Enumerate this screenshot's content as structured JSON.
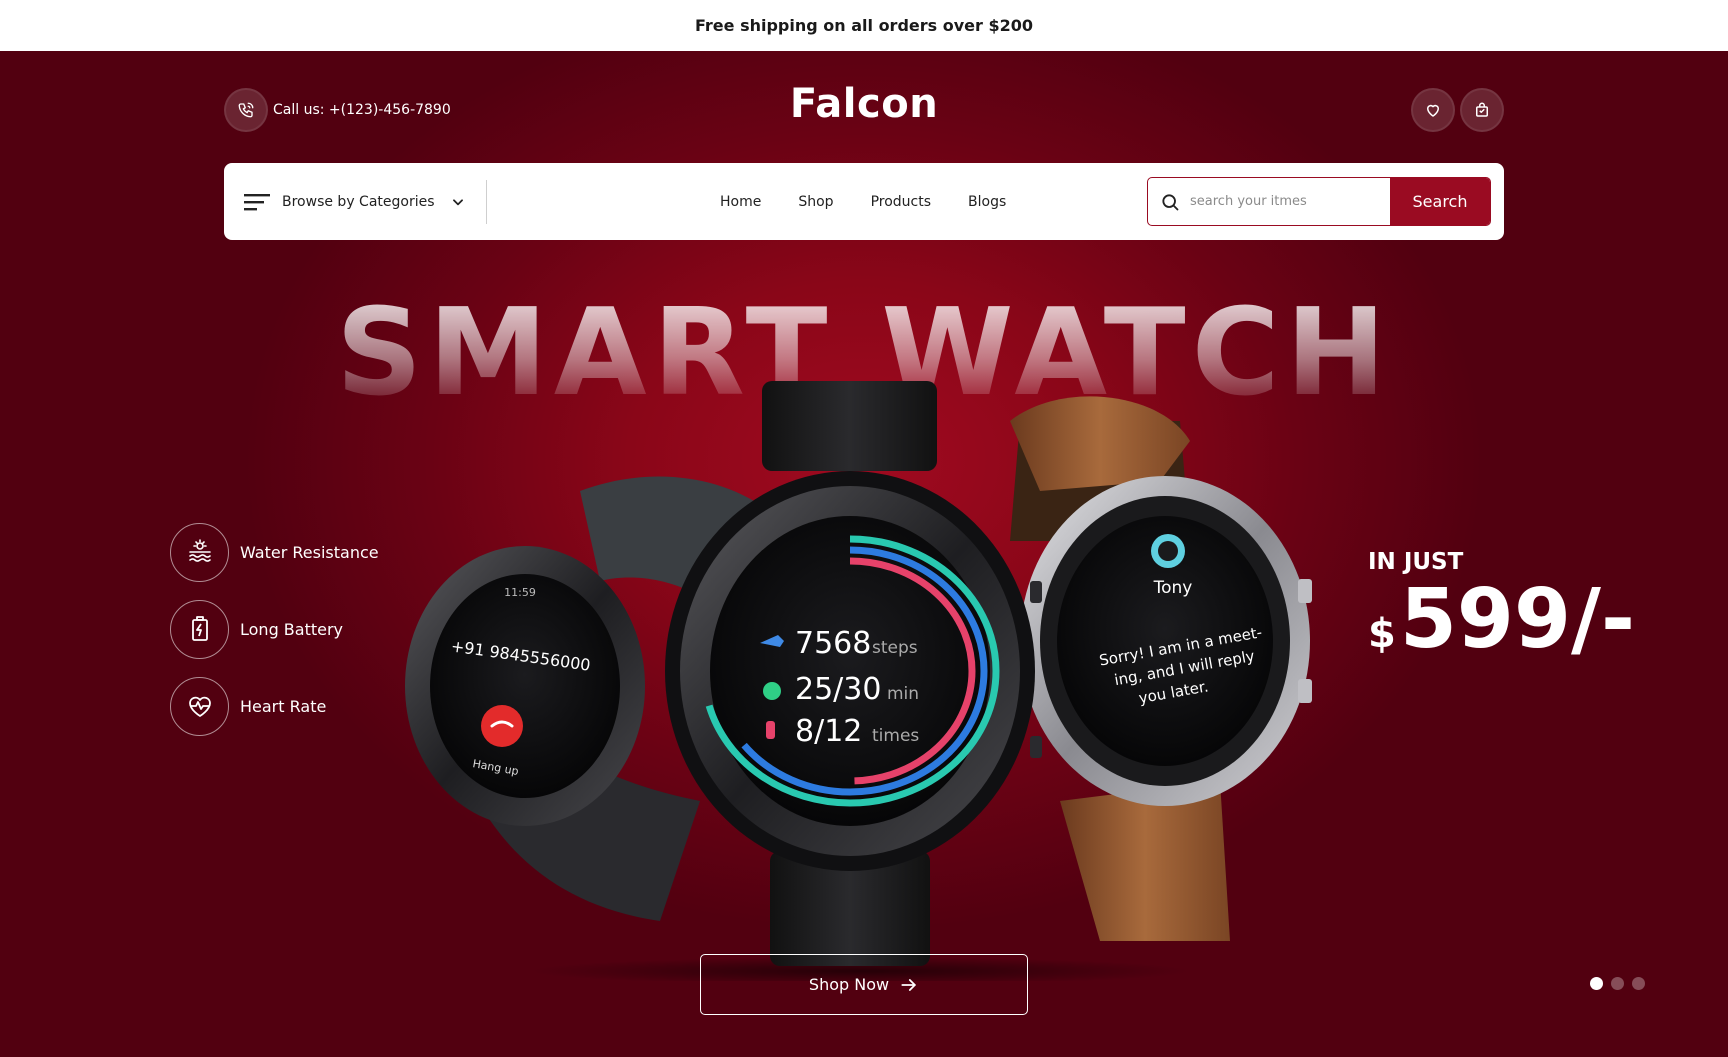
{
  "announcement": "Free shipping on all orders over $200",
  "header": {
    "phone_label": "Call us: +(123)-456-7890",
    "logo": "Falcon",
    "icons": [
      "heart-icon",
      "shopping-bag-icon"
    ]
  },
  "nav": {
    "browse_label": "Browse by Categories",
    "menu": [
      "Home",
      "Shop",
      "Products",
      "Blogs"
    ],
    "search_placeholder": "search your itmes",
    "search_button": "Search"
  },
  "hero": {
    "headline": "SMART WATCH",
    "features": [
      {
        "label": "Water Resistance",
        "icon": "water-icon"
      },
      {
        "label": "Long Battery",
        "icon": "battery-icon"
      },
      {
        "label": "Heart Rate",
        "icon": "heart-rate-icon"
      }
    ],
    "price_prefix": "IN JUST",
    "currency": "$",
    "price": "599/-",
    "cta": "Shop Now",
    "slides": {
      "count": 3,
      "active": 1
    },
    "watches": {
      "left": {
        "number": "+91 9845556000",
        "time": "11:59",
        "action": "Hang up"
      },
      "center": {
        "steps": "7568",
        "steps_unit": "steps",
        "minutes": "25/30",
        "minutes_unit": "min",
        "times": "8/12",
        "times_unit": "times"
      },
      "right": {
        "name": "Tony",
        "message": [
          "Sorry! I am in a meet-",
          "ing, and I will reply",
          "you later."
        ]
      }
    }
  },
  "colors": {
    "accent": "#9a0b22",
    "background": "#6a0214",
    "white": "#ffffff"
  }
}
